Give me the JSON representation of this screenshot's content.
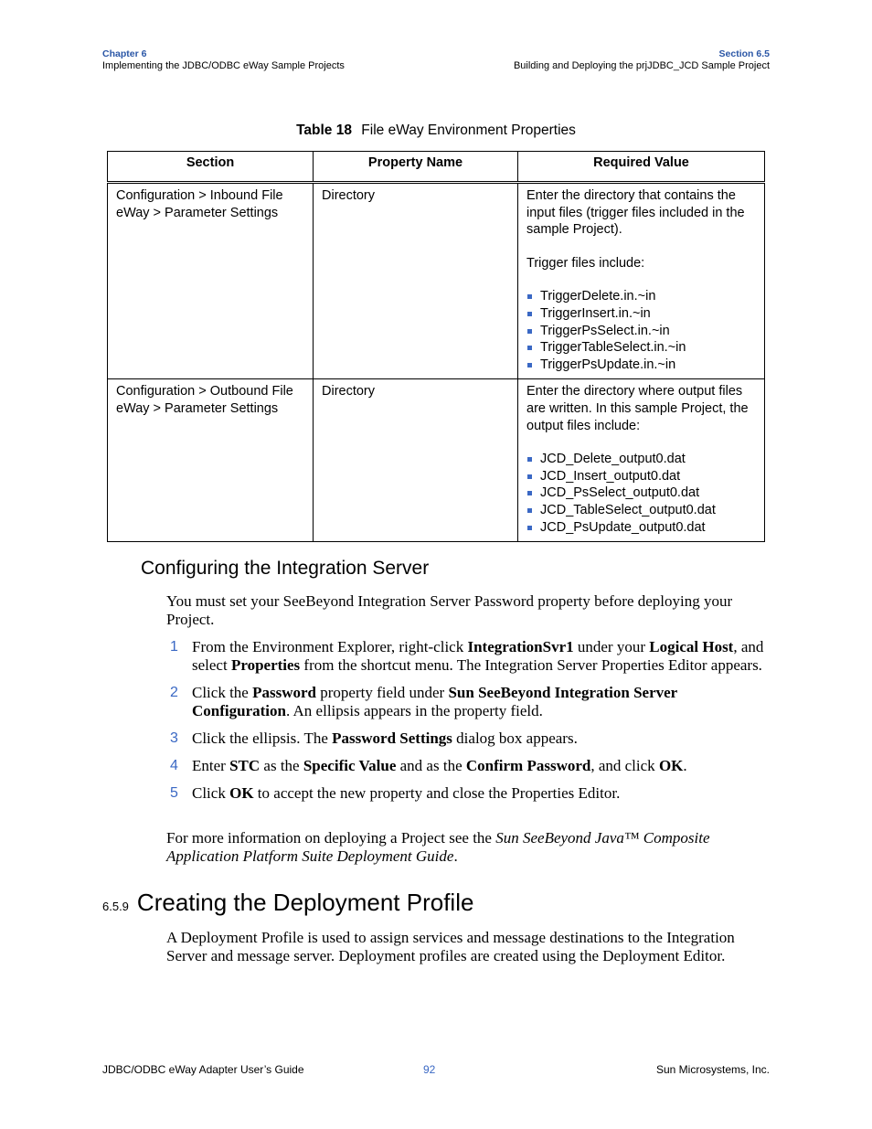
{
  "header": {
    "chapter_label": "Chapter 6",
    "chapter_title": "Implementing the JDBC/ODBC eWay Sample Projects",
    "section_label": "Section 6.5",
    "section_title": "Building and Deploying the prjJDBC_JCD Sample Project"
  },
  "table": {
    "caption_number": "Table 18",
    "caption_title": "File eWay Environment Properties",
    "columns": [
      "Section",
      "Property Name",
      "Required Value"
    ],
    "rows": [
      {
        "section": "Configuration > Inbound File eWay > Parameter Settings",
        "property": "Directory",
        "value_intro": "Enter the directory that contains the input files (trigger files included in the sample Project).",
        "value_sub": "Trigger files include:",
        "items": [
          "TriggerDelete.in.~in",
          "TriggerInsert.in.~in",
          "TriggerPsSelect.in.~in",
          "TriggerTableSelect.in.~in",
          "TriggerPsUpdate.in.~in"
        ]
      },
      {
        "section": "Configuration > Outbound File eWay > Parameter Settings",
        "property": "Directory",
        "value_intro": "Enter the directory where output files are written. In this sample Project, the output files include:",
        "value_sub": "",
        "items": [
          "JCD_Delete_output0.dat",
          "JCD_Insert_output0.dat",
          "JCD_PsSelect_output0.dat",
          "JCD_TableSelect_output0.dat",
          "JCD_PsUpdate_output0.dat"
        ]
      }
    ]
  },
  "integration_server": {
    "heading": "Configuring the Integration Server",
    "intro": "You must set your SeeBeyond Integration Server Password property before deploying your Project.",
    "steps": [
      {
        "num": "1",
        "parts": [
          "From the Environment Explorer, right-click ",
          "IntegrationSvr1",
          " under your ",
          "Logical Host",
          ", and select ",
          "Properties",
          " from the shortcut menu. The Integration Server Properties Editor appears."
        ]
      },
      {
        "num": "2",
        "parts": [
          "Click the ",
          "Password",
          " property field under ",
          "Sun SeeBeyond Integration Server Configuration",
          ". An ellipsis appears in the property field."
        ]
      },
      {
        "num": "3",
        "parts": [
          "Click the ellipsis. The ",
          "Password Settings",
          " dialog box appears."
        ]
      },
      {
        "num": "4",
        "parts": [
          "Enter ",
          "STC",
          " as the ",
          "Specific Value",
          " and as the ",
          "Confirm Password",
          ", and click ",
          "OK",
          "."
        ]
      },
      {
        "num": "5",
        "parts": [
          "Click ",
          "OK",
          " to accept the new property and close the Properties Editor."
        ]
      }
    ],
    "more_info_prefix": "For more information on deploying a Project see the ",
    "more_info_title": "Sun SeeBeyond Java™ Composite Application Platform Suite Deployment Guide",
    "more_info_suffix": "."
  },
  "deployment_profile": {
    "section_number": "6.5.9",
    "heading": "Creating the Deployment Profile",
    "body": "A Deployment Profile is used to assign services and message destinations to the Integration Server and message server. Deployment profiles are created using the Deployment Editor."
  },
  "footer": {
    "guide": "JDBC/ODBC eWay Adapter User’s Guide",
    "page": "92",
    "company": "Sun Microsystems, Inc."
  }
}
